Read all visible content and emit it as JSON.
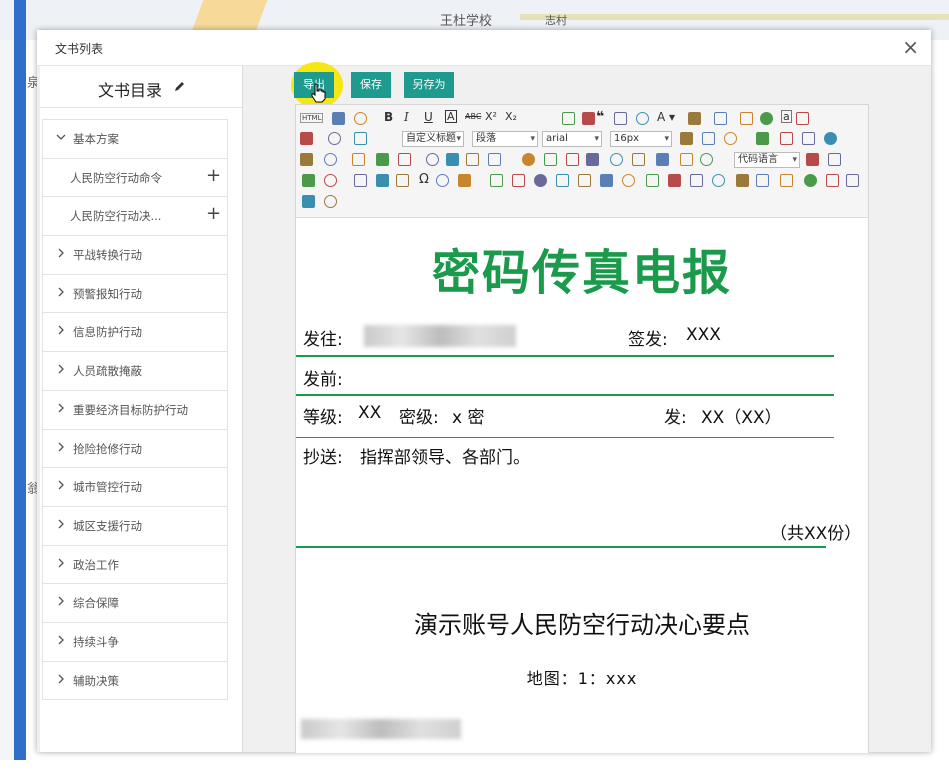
{
  "map": {
    "labels": [
      "王杜学校",
      "志村"
    ]
  },
  "side_chars": [
    "泉",
    "翁"
  ],
  "dialog": {
    "title": "文书列表",
    "close_glyph": "×"
  },
  "directory": {
    "title": "文书目录",
    "items": [
      {
        "label": "基本方案",
        "expanded": true
      },
      {
        "label": "人民防空行动命令",
        "child": true,
        "plus": "+"
      },
      {
        "label": "人民防空行动决...",
        "child": true,
        "plus": "+"
      },
      {
        "label": "平战转换行动"
      },
      {
        "label": "预警报知行动"
      },
      {
        "label": "信息防护行动"
      },
      {
        "label": "人员疏散掩蔽"
      },
      {
        "label": "重要经济目标防护行动"
      },
      {
        "label": "抢险抢修行动"
      },
      {
        "label": "城市管控行动"
      },
      {
        "label": "城区支援行动"
      },
      {
        "label": "政治工作"
      },
      {
        "label": "综合保障"
      },
      {
        "label": "持续斗争"
      },
      {
        "label": "辅助决策"
      }
    ]
  },
  "toolbar": {
    "export_label": "导出",
    "save_label": "保存",
    "save_as_label": "另存为",
    "html_label": "HTML",
    "custom_title_select": "自定义标题",
    "paragraph_select": "段落",
    "font_select": "arial",
    "size_select": "16px",
    "code_lang_select": "代码语言"
  },
  "document": {
    "title": "密码传真电报",
    "to_label": "发往:",
    "sign_label": "签发:",
    "sign_value": "XXX",
    "before_label": "发前:",
    "level_label": "等级:",
    "level_value": "XX",
    "secret_label": "密级:",
    "secret_value": "x  密",
    "send_label": "发:",
    "send_value": "XX（XX）",
    "cc_label": "抄送:",
    "cc_value": "指挥部领导、各部门。",
    "copies": "（共XX份）",
    "subtitle": "演示账号人民防空行动决心要点",
    "map_scale": "地图：1：xxx"
  },
  "colors": {
    "accent": "#1e9a8e",
    "doc_green": "#1a9a4a",
    "highlight": "#f5e716"
  }
}
